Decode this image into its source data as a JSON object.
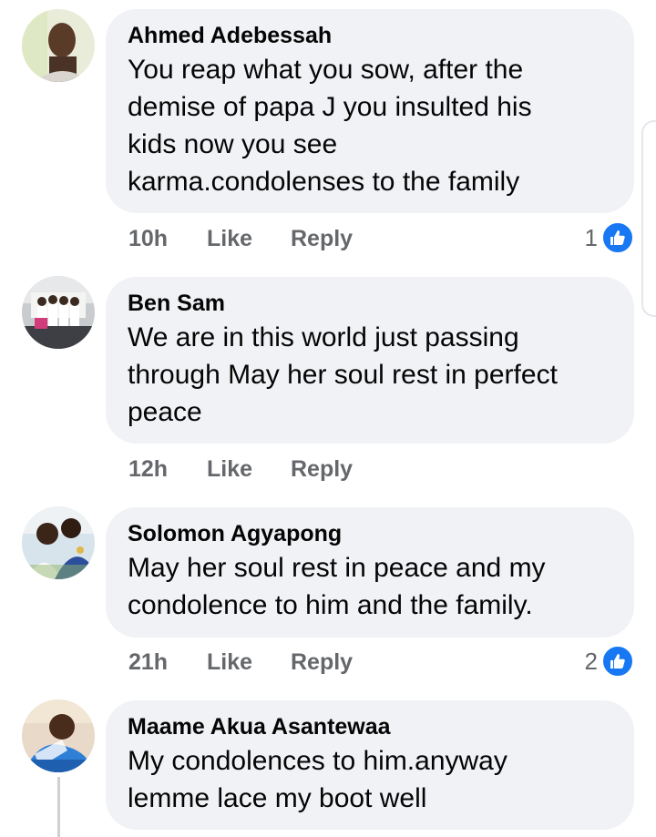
{
  "comments": [
    {
      "author": "Ahmed Adebessah",
      "text": "You reap what you sow, after the\ndemise of papa J you insulted his\nkids now you see\nkarma.condolenses to the family",
      "time": "10h",
      "like_label": "Like",
      "reply_label": "Reply",
      "reaction_count": "1",
      "reaction_icon": "thumbs-up-icon"
    },
    {
      "author": "Ben Sam",
      "text": "We are in this world just passing\nthrough May her soul rest in perfect\npeace",
      "time": "12h",
      "like_label": "Like",
      "reply_label": "Reply"
    },
    {
      "author": "Solomon Agyapong",
      "text": "May her soul rest in peace and my\ncondolence to him and the family.",
      "time": "21h",
      "like_label": "Like",
      "reply_label": "Reply",
      "reaction_count": "2",
      "reaction_icon": "thumbs-up-icon"
    },
    {
      "author": "Maame Akua Asantewaa",
      "text": "My condolences to him.anyway\nlemme lace my boot well"
    }
  ],
  "colors": {
    "bubble": "#f0f2f5",
    "meta_text": "#65676b",
    "like_blue": "#1877f2"
  }
}
